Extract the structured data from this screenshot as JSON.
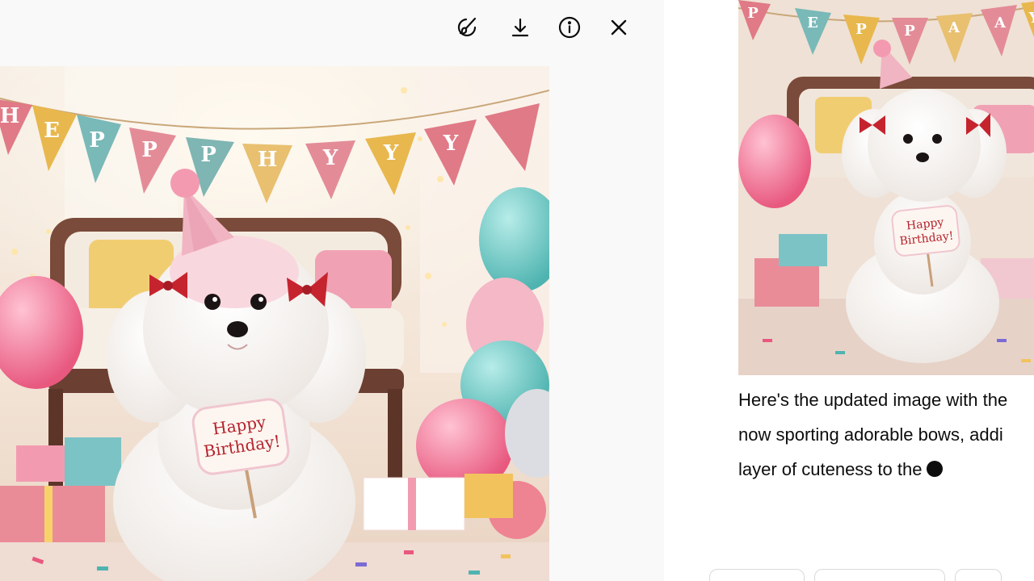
{
  "toolbar": {
    "icons": [
      "edit-brush-icon",
      "download-icon",
      "info-icon",
      "close-icon"
    ]
  },
  "image": {
    "bunting_letters": [
      "H",
      "E",
      "P",
      "P",
      "P",
      "H",
      "Y",
      "Y",
      "Y"
    ],
    "sign_line1": "Happy",
    "sign_line2": "Birthday!"
  },
  "thumbnail": {
    "bunting_letters": [
      "P",
      "E",
      "P",
      "P",
      "A",
      "A",
      "Y"
    ],
    "sign_line1": "Happy",
    "sign_line2": "Birthday!"
  },
  "message": {
    "lines": [
      "Here's the updated image with the",
      "now sporting adorable bows, addi",
      "layer of cuteness to the"
    ]
  },
  "colors": {
    "text": "#0d0d0d",
    "icon": "#0d0d0d",
    "viewer_bg": "#f9f9f9",
    "chat_bg": "#ffffff"
  }
}
